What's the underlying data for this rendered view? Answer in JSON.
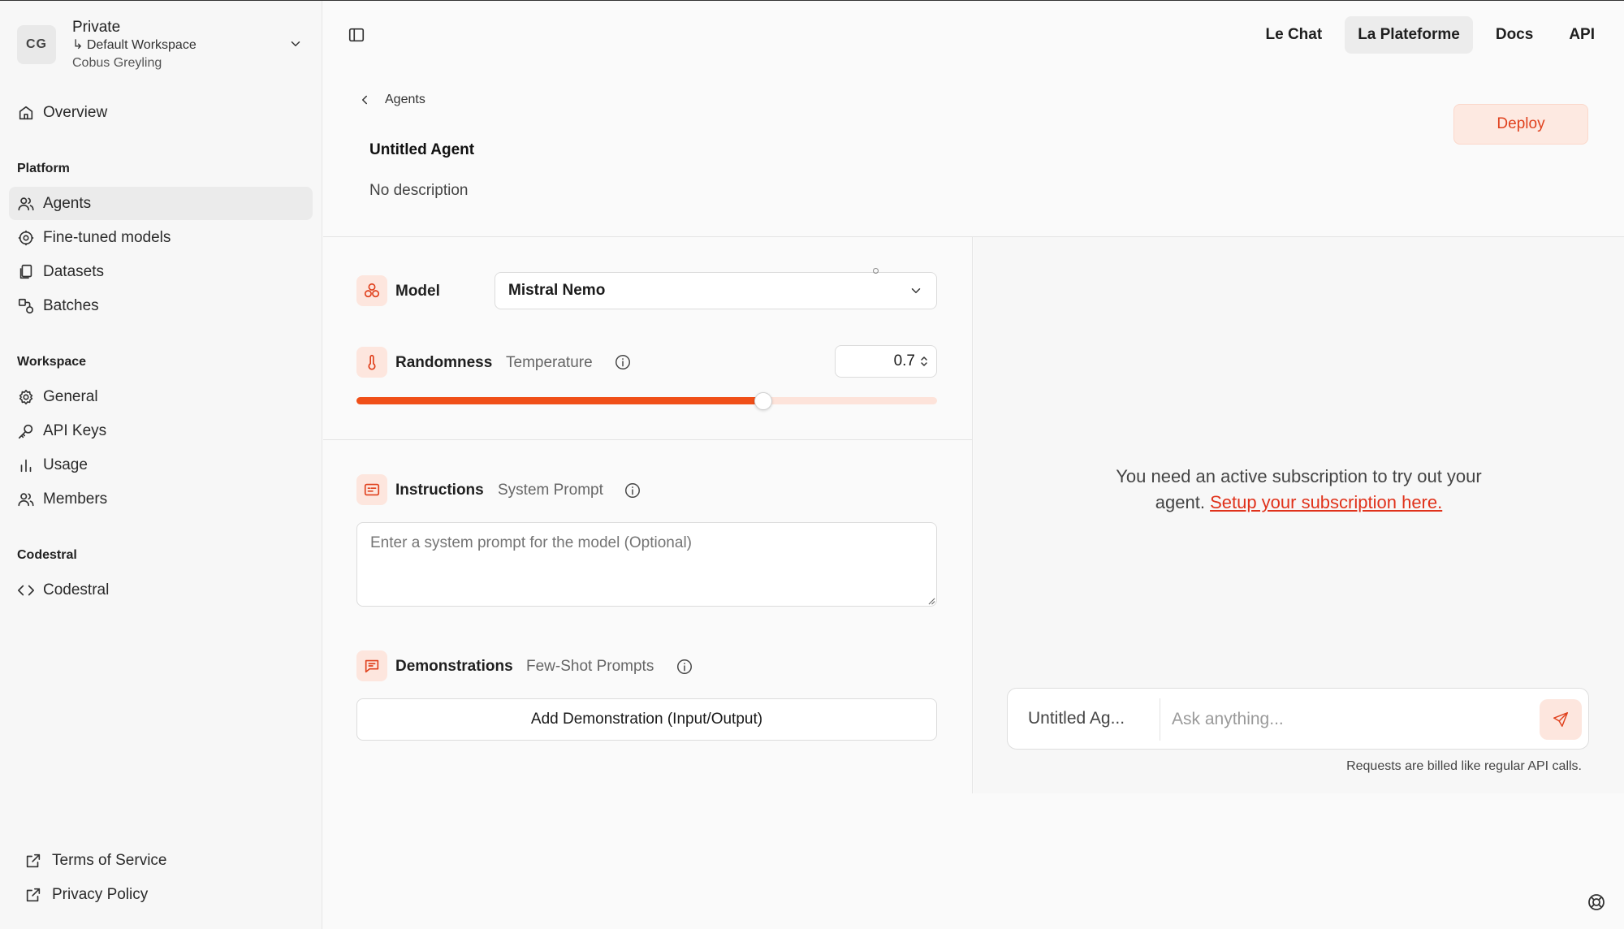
{
  "workspace": {
    "initials": "CG",
    "title": "Private",
    "subtitle": "↳ Default Workspace",
    "user": "Cobus Greyling"
  },
  "sidebar": {
    "overview": "Overview",
    "platform_heading": "Platform",
    "platform_items": [
      "Agents",
      "Fine-tuned models",
      "Datasets",
      "Batches"
    ],
    "workspace_heading": "Workspace",
    "workspace_items": [
      "General",
      "API Keys",
      "Usage",
      "Members"
    ],
    "codestral_heading": "Codestral",
    "codestral_items": [
      "Codestral"
    ],
    "footer": [
      "Terms of Service",
      "Privacy Policy"
    ]
  },
  "topnav": [
    "Le Chat",
    "La Plateforme",
    "Docs",
    "API"
  ],
  "header": {
    "breadcrumb": "Agents",
    "agent_title": "Untitled Agent",
    "agent_desc": "No description",
    "deploy": "Deploy"
  },
  "config": {
    "model_label": "Model",
    "model_value": "Mistral Nemo",
    "randomness_label": "Randomness",
    "temperature_label": "Temperature",
    "temperature_value": "0.7",
    "temperature_fraction": 0.7,
    "instructions_label": "Instructions",
    "system_prompt_label": "System Prompt",
    "system_prompt_placeholder": "Enter a system prompt for the model (Optional)",
    "demonstrations_label": "Demonstrations",
    "few_shot_label": "Few-Shot Prompts",
    "add_demo": "Add Demonstration (Input/Output)"
  },
  "chat": {
    "message_part1": "You need an active subscription to try out your",
    "message_part2": "agent.",
    "link": "Setup your subscription here.",
    "agent_name": "Untitled Ag...",
    "placeholder": "Ask anything...",
    "billing": "Requests are billed like regular API calls."
  },
  "colors": {
    "accent": "#f04f18",
    "accent_soft": "#fde6de",
    "link": "#e0321b"
  }
}
